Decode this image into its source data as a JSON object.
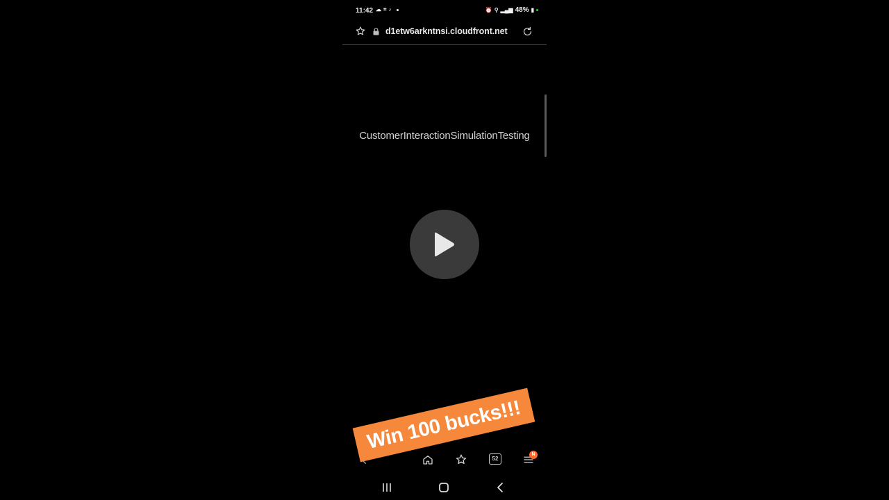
{
  "status_bar": {
    "time": "11:42",
    "battery": "48%"
  },
  "browser": {
    "url": "d1etw6arkntnsi.cloudfront.net"
  },
  "page": {
    "heading": "CustomerInteractionSimulationTesting"
  },
  "toolbar": {
    "tabs_count": "52",
    "menu_badge": "N"
  },
  "overlay": {
    "promo_text": "Win 100 bucks!!!"
  },
  "colors": {
    "background": "#000000",
    "promo": "#f6883c",
    "badge": "#ff6b2c"
  }
}
